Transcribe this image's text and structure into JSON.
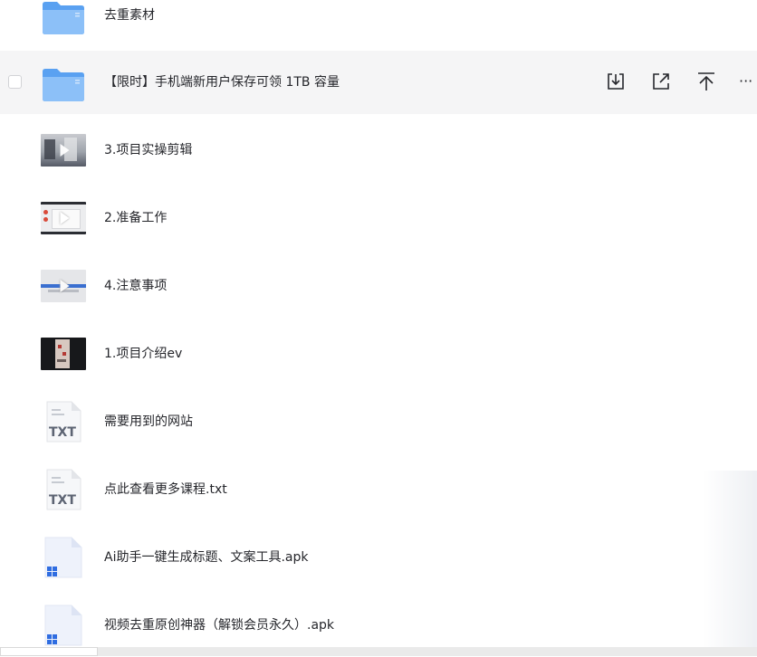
{
  "files": [
    {
      "name": "去重素材",
      "type": "folder"
    },
    {
      "name": "【限时】手机端新用户保存可领 1TB 容量",
      "type": "folder",
      "hovered": true
    },
    {
      "name": "3.项目实操剪辑",
      "type": "video"
    },
    {
      "name": "2.准备工作",
      "type": "video"
    },
    {
      "name": "4.注意事项",
      "type": "video"
    },
    {
      "name": "1.项目介绍ev",
      "type": "video"
    },
    {
      "name": "需要用到的网站",
      "type": "txt"
    },
    {
      "name": "点此查看更多课程.txt",
      "type": "txt"
    },
    {
      "name": "Ai助手一键生成标题、文案工具.apk",
      "type": "apk"
    },
    {
      "name": "视频去重原创神器（解锁会员永久）.apk",
      "type": "apk"
    }
  ],
  "txt_icon_label": "TXT",
  "row_actions": [
    "download-icon",
    "share-icon",
    "upload-top-icon",
    "more-icon"
  ],
  "more_glyph": "···",
  "colors": {
    "folder": "#5aa1f1",
    "folder_light": "#8cc0f8",
    "hover_bg": "#f5f5f6",
    "txt_text": "#5d6473"
  }
}
